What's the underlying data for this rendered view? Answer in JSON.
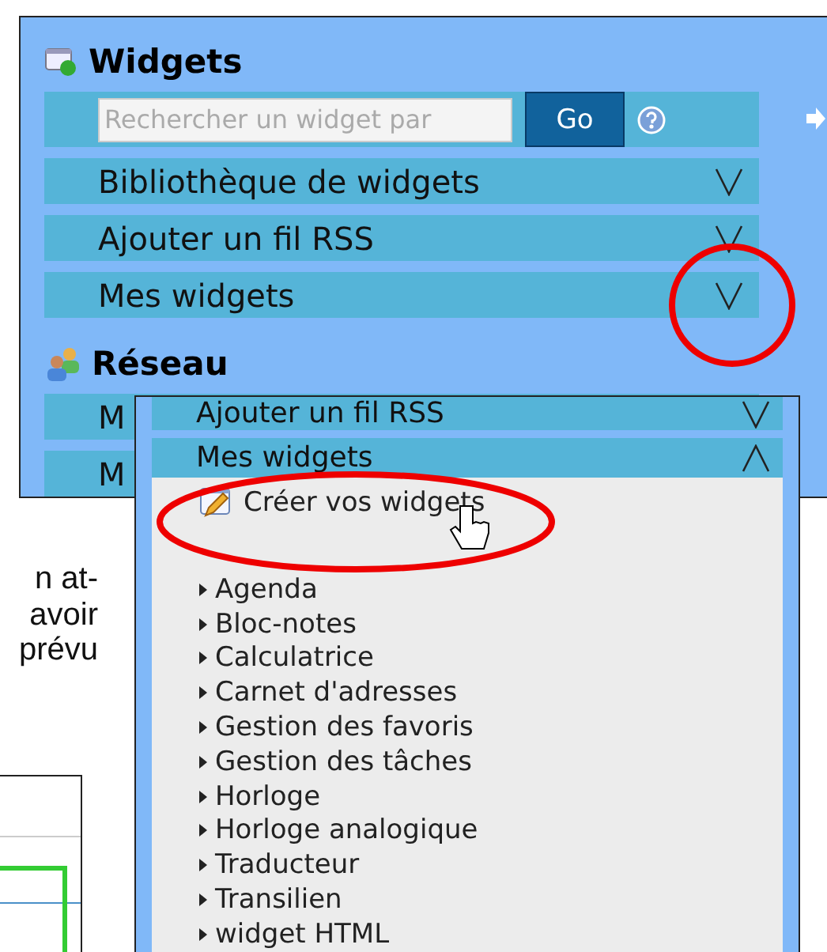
{
  "back_panel": {
    "title": "Widgets",
    "search": {
      "placeholder": "Rechercher un widget par",
      "button": "Go"
    },
    "sections": [
      {
        "label": "Bibliothèque de widgets",
        "expanded": false
      },
      {
        "label": "Ajouter un fil RSS",
        "expanded": false
      },
      {
        "label": "Mes widgets",
        "expanded": false
      }
    ],
    "network": {
      "title": "Réseau",
      "rows": [
        "M",
        "M"
      ]
    }
  },
  "front_panel": {
    "sections": [
      {
        "label": "Ajouter un fil RSS",
        "expanded": false
      },
      {
        "label": "Mes widgets",
        "expanded": true
      }
    ],
    "create_link": "Créer vos widgets",
    "widgets": [
      "Agenda",
      "Bloc-notes",
      "Calculatrice",
      "Carnet d'adresses",
      "Gestion des favoris",
      "Gestion des tâches",
      "Horloge",
      "Horloge analogique",
      "Traducteur",
      "Transilien",
      "widget HTML"
    ]
  },
  "body_text": [
    "n at-",
    "avoir",
    "prévu"
  ]
}
